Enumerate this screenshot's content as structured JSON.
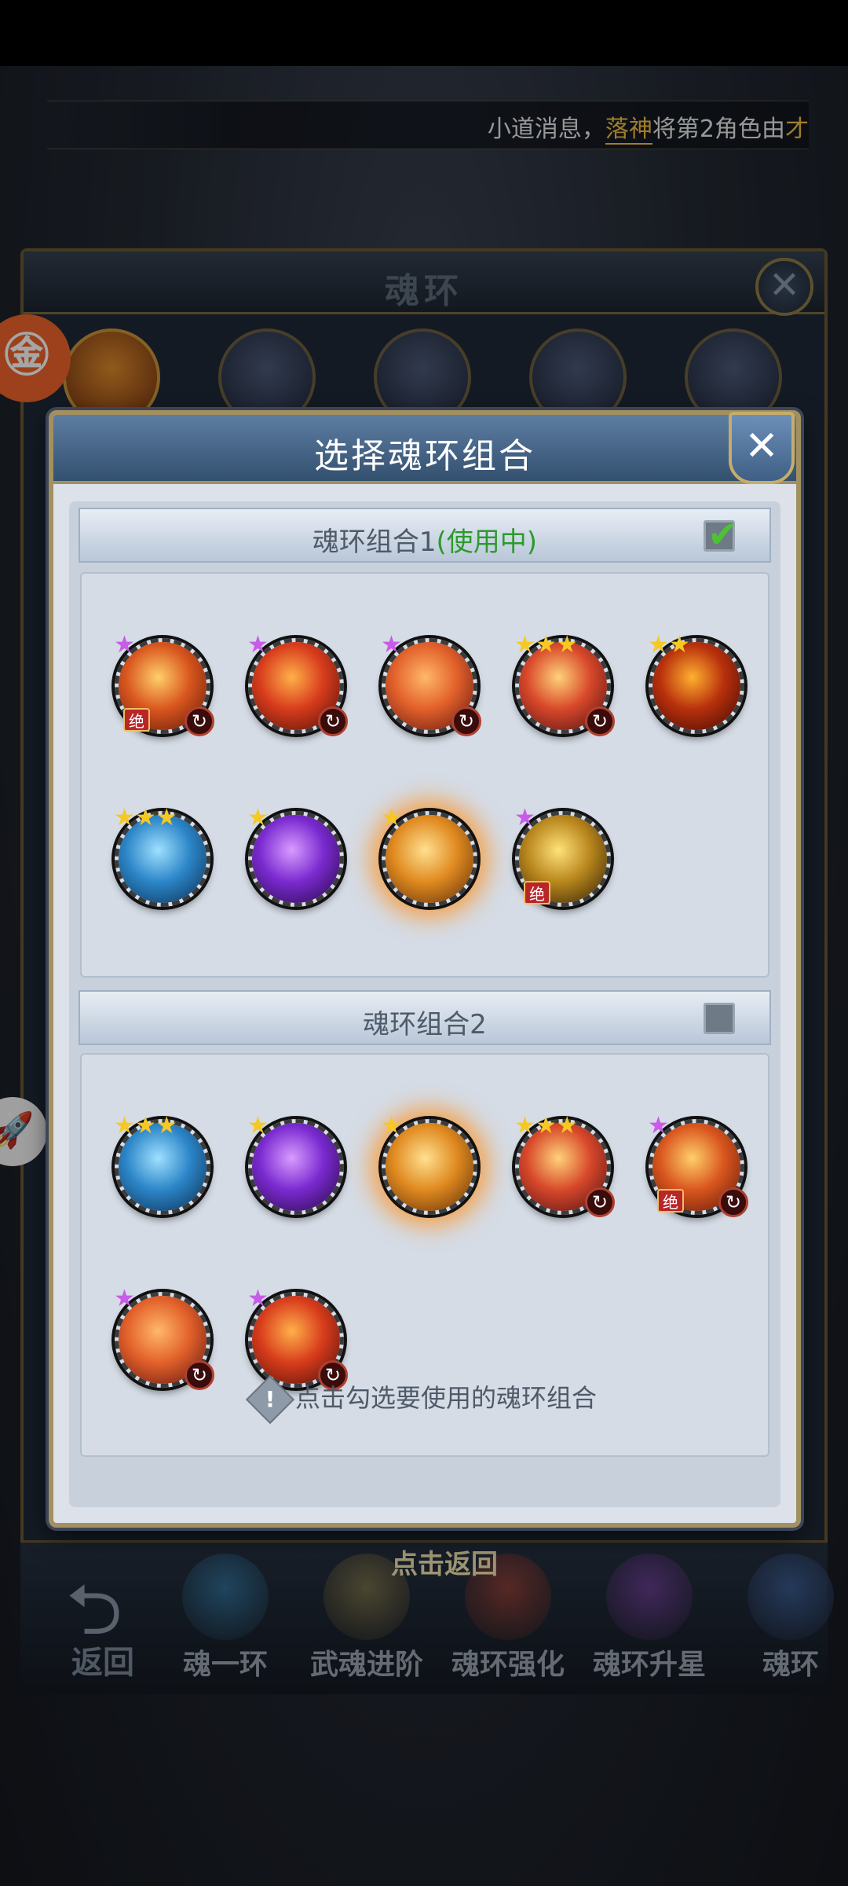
{
  "broadcast": {
    "prefix": "小道消息，",
    "highlight": "落神",
    "suffix": "将第2角色由",
    "tail": "才"
  },
  "background_panel": {
    "title": "魂环",
    "close_glyph": "✕",
    "back_label": "返回",
    "tap_return": "点击返回",
    "tabs": [
      {
        "label": "魂一环",
        "color": "#3f9fd8"
      },
      {
        "label": "武魂进阶",
        "color": "#b8a25a"
      },
      {
        "label": "魂环强化",
        "color": "#d8503a"
      },
      {
        "label": "魂环升星",
        "color": "#9a4fd0"
      },
      {
        "label": "魂环",
        "color": "#4f7fd0"
      }
    ]
  },
  "float_buttons": {
    "orange_glyph": "㊎",
    "white_glyph": "🚀"
  },
  "modal": {
    "title": "选择魂环组合",
    "close_glyph": "✕",
    "groups": [
      {
        "label": "魂环组合1",
        "status": "(使用中)",
        "checked": true,
        "rings": [
          {
            "stars": "★",
            "star_color": "purple",
            "jue": "绝",
            "cycle": true,
            "palette": [
              "#ffcf6a",
              "#d9561e",
              "#5a1608"
            ]
          },
          {
            "stars": "★",
            "star_color": "purple",
            "jue": "",
            "cycle": true,
            "palette": [
              "#ffb04a",
              "#d83c1c",
              "#4a0e08"
            ]
          },
          {
            "stars": "★",
            "star_color": "purple",
            "jue": "",
            "cycle": true,
            "palette": [
              "#ffb86a",
              "#e2602a",
              "#5a1410"
            ]
          },
          {
            "stars": "★★★",
            "star_color": "gold",
            "jue": "",
            "cycle": true,
            "palette": [
              "#ffd27a",
              "#d8482a",
              "#4a0e14"
            ]
          },
          {
            "stars": "★★",
            "star_color": "gold",
            "jue": "",
            "cycle": false,
            "palette": [
              "#ffb030",
              "#b8300c",
              "#3a0804"
            ]
          },
          {
            "stars": "★★★",
            "star_color": "gold",
            "jue": "",
            "cycle": false,
            "palette": [
              "#9fe0ff",
              "#2c86c8",
              "#0a2a4c"
            ]
          },
          {
            "stars": "★",
            "star_color": "gold",
            "jue": "",
            "cycle": false,
            "palette": [
              "#d89cff",
              "#7a2ad0",
              "#24083c"
            ]
          },
          {
            "stars": "★",
            "star_color": "gold",
            "jue": "",
            "cycle": false,
            "glow": true,
            "palette": [
              "#ffe090",
              "#e08a20",
              "#5a2a08"
            ]
          },
          {
            "stars": "★",
            "star_color": "purple",
            "jue": "绝",
            "cycle": false,
            "palette": [
              "#ffe27a",
              "#b8861c",
              "#2a1c08"
            ]
          }
        ]
      },
      {
        "label": "魂环组合2",
        "status": "",
        "checked": false,
        "rings": [
          {
            "stars": "★★★",
            "star_color": "gold",
            "jue": "",
            "cycle": false,
            "palette": [
              "#9fe0ff",
              "#2c86c8",
              "#0a2a4c"
            ]
          },
          {
            "stars": "★",
            "star_color": "gold",
            "jue": "",
            "cycle": false,
            "palette": [
              "#d89cff",
              "#7a2ad0",
              "#24083c"
            ]
          },
          {
            "stars": "★",
            "star_color": "gold",
            "jue": "",
            "cycle": false,
            "glow": true,
            "palette": [
              "#ffe090",
              "#e08a20",
              "#5a2a08"
            ]
          },
          {
            "stars": "★★★",
            "star_color": "gold",
            "jue": "",
            "cycle": true,
            "palette": [
              "#ffd27a",
              "#d8482a",
              "#4a0e14"
            ]
          },
          {
            "stars": "★",
            "star_color": "purple",
            "jue": "绝",
            "cycle": true,
            "palette": [
              "#ffcf6a",
              "#d9561e",
              "#5a1608"
            ]
          },
          {
            "stars": "★",
            "star_color": "purple",
            "jue": "",
            "cycle": true,
            "palette": [
              "#ffb86a",
              "#e2602a",
              "#5a1410"
            ]
          },
          {
            "stars": "★",
            "star_color": "purple",
            "jue": "",
            "cycle": true,
            "palette": [
              "#ffb04a",
              "#d83c1c",
              "#4a0e08"
            ]
          }
        ]
      }
    ],
    "tip_icon": "!",
    "tip": "点击勾选要使用的魂环组合",
    "check_glyph": "✔",
    "cycle_glyph": "↻"
  }
}
